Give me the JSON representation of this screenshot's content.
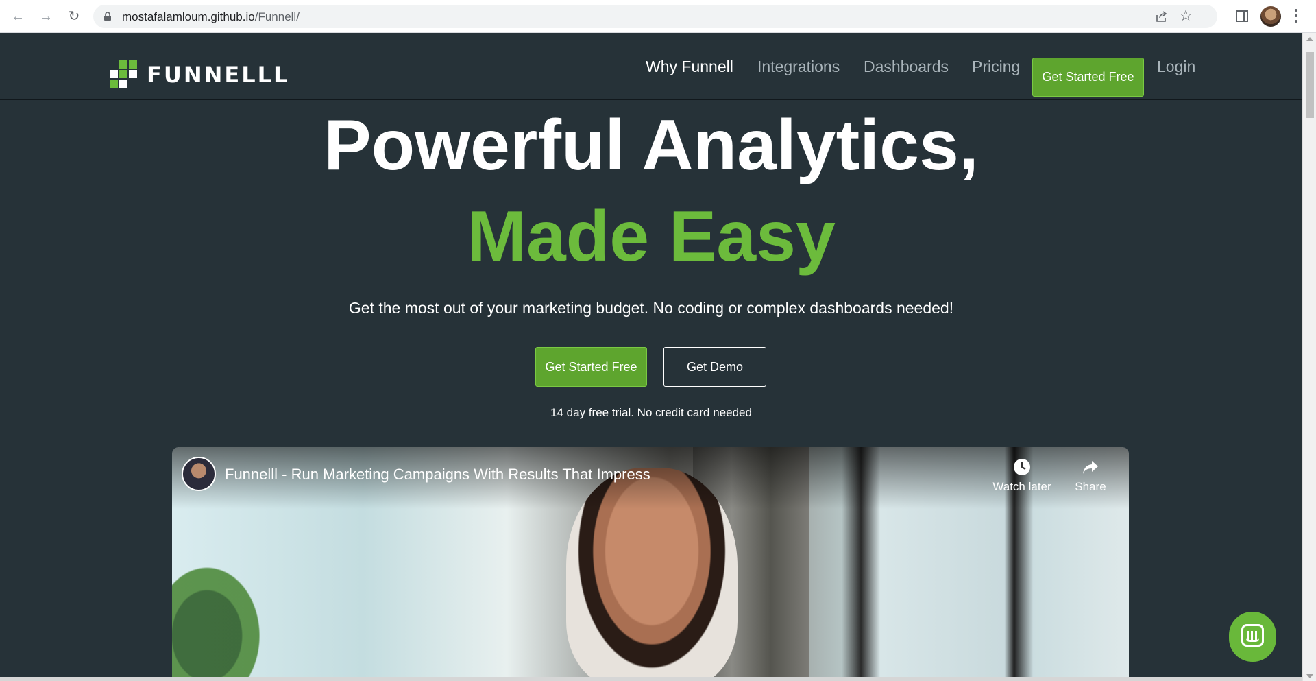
{
  "browser": {
    "url_host": "mostafalamloum.github.io",
    "url_path": "/Funnell/",
    "icons": [
      "back-icon",
      "forward-icon",
      "reload-icon",
      "lock-icon",
      "share-icon",
      "star-icon",
      "side-panel-icon",
      "profile-avatar",
      "kebab-menu-icon"
    ]
  },
  "header": {
    "logo_text": "FUNNELLL",
    "nav": [
      {
        "label": "Why Funnell"
      },
      {
        "label": "Integrations"
      },
      {
        "label": "Dashboards"
      },
      {
        "label": "Pricing"
      }
    ],
    "cta_label": "Get Started Free",
    "login_label": "Login"
  },
  "hero": {
    "title_line1": "Powerful Analytics,",
    "title_line2": "Made Easy",
    "subtitle": "Get the most out of your marketing budget. No coding or complex dashboards needed!",
    "primary_button": "Get Started Free",
    "secondary_button": "Get Demo",
    "trial_note": "14 day free trial. No credit card needed"
  },
  "video": {
    "title": "Funnelll - Run Marketing Campaigns With Results That Impress",
    "watch_later_label": "Watch later",
    "share_label": "Share"
  },
  "colors": {
    "background": "#263238",
    "accent_green": "#6cbb3c",
    "button_green": "#5ea52e"
  }
}
